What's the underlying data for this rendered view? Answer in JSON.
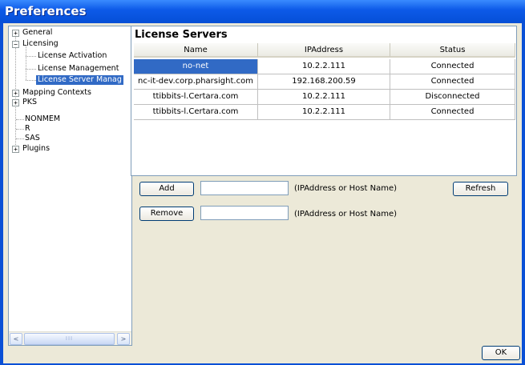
{
  "window": {
    "title": "Preferences"
  },
  "tree": {
    "items": [
      {
        "label": "General",
        "expander": "+"
      },
      {
        "label": "Licensing",
        "expander": "−"
      },
      {
        "label": "License Activation"
      },
      {
        "label": "License Management"
      },
      {
        "label": "License Server Manag"
      },
      {
        "label": "Mapping Contexts",
        "expander": "+"
      },
      {
        "label": "PKS",
        "expander": "+"
      },
      {
        "label": "NONMEM"
      },
      {
        "label": "R"
      },
      {
        "label": "SAS"
      },
      {
        "label": "Plugins",
        "expander": "+"
      }
    ],
    "scroll": {
      "left_arrow": "<",
      "right_arrow": ">",
      "thumb_grip": "III"
    }
  },
  "license_servers": {
    "title": "License Servers",
    "columns": [
      "Name",
      "IPAddress",
      "Status"
    ],
    "rows": [
      {
        "name": "no-net",
        "ip": "10.2.2.111",
        "status": "Connected",
        "selected": true
      },
      {
        "name": "nc-it-dev.corp.pharsight.com",
        "ip": "192.168.200.59",
        "status": "Connected"
      },
      {
        "name": "ttibbits-l.Certara.com",
        "ip": "10.2.2.111",
        "status": "Disconnected"
      },
      {
        "name": "ttibbits-l.Certara.com",
        "ip": "10.2.2.111",
        "status": "Connected"
      }
    ]
  },
  "controls": {
    "add_label": "Add",
    "add_value": "",
    "add_hint": "(IPAddress or Host Name)",
    "refresh_label": "Refresh",
    "remove_label": "Remove",
    "remove_value": "",
    "remove_hint": "(IPAddress or Host Name)",
    "ok_label": "OK"
  },
  "colors": {
    "title_bar": "#0a50d6",
    "selection": "#316ac5",
    "face": "#ece9d8"
  }
}
